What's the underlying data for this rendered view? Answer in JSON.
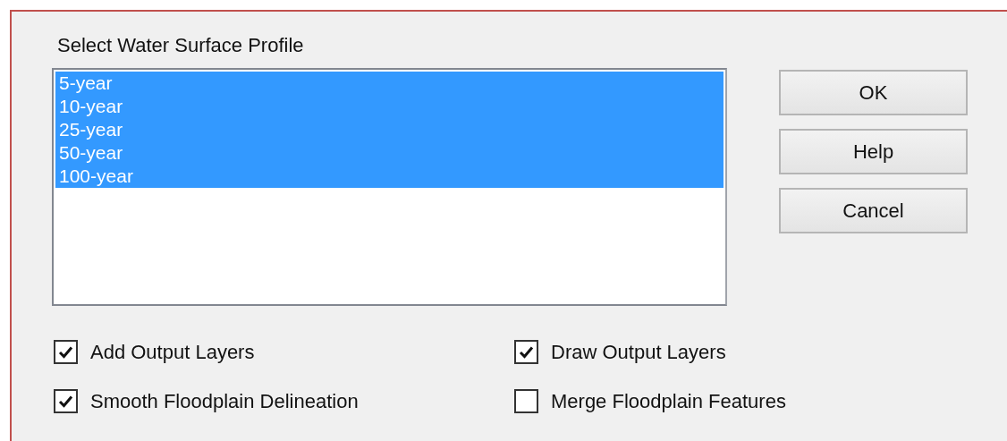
{
  "dialog": {
    "heading": "Select Water Surface Profile",
    "profiles": [
      {
        "label": "5-year",
        "selected": true
      },
      {
        "label": "10-year",
        "selected": true
      },
      {
        "label": "25-year",
        "selected": true
      },
      {
        "label": "50-year",
        "selected": true
      },
      {
        "label": "100-year",
        "selected": true
      }
    ],
    "buttons": [
      "OK",
      "Help",
      "Cancel"
    ],
    "options": [
      {
        "label": "Add Output Layers",
        "checked": true
      },
      {
        "label": "Draw Output Layers",
        "checked": true
      },
      {
        "label": "Smooth Floodplain Delineation",
        "checked": true
      },
      {
        "label": "Merge Floodplain Features",
        "checked": false
      }
    ]
  }
}
